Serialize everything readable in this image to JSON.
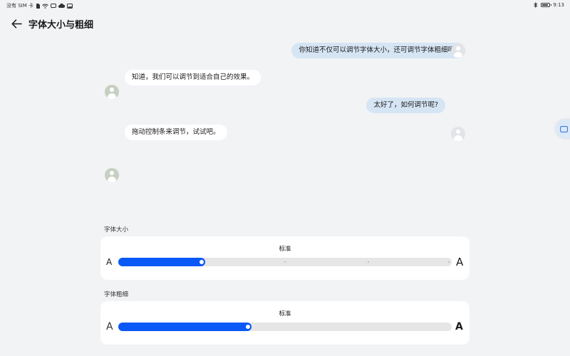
{
  "status_bar": {
    "carrier": "没有 SIM 卡",
    "time": "9:13",
    "battery_level": 0.85,
    "icons_left": [
      "no-sim-icon",
      "wifi-icon",
      "message-icon",
      "cloud-icon",
      "gallery-icon"
    ],
    "icons_right": [
      "bluetooth-icon",
      "battery-icon"
    ]
  },
  "header": {
    "title": "字体大小与粗细",
    "back_icon": "arrow-left-icon"
  },
  "chat": {
    "messages": [
      {
        "side": "right",
        "text": "你知道不仅可以调节字体大小，还可调节字体粗细吗?"
      },
      {
        "side": "left",
        "text": "知道，我们可以调节到适合自己的效果。"
      },
      {
        "side": "right",
        "text": "太好了，如何调节呢?"
      },
      {
        "side": "left",
        "text": "拖动控制条来调节，试试吧。"
      }
    ]
  },
  "font_size": {
    "label": "字体大小",
    "value_label": "标准",
    "min_glyph": "A",
    "max_glyph": "A",
    "level": 0.26,
    "ticks": [
      0.5,
      0.75,
      1.0
    ]
  },
  "font_weight": {
    "label": "字体粗细",
    "value_label": "标准",
    "min_glyph": "A",
    "max_glyph": "A",
    "level": 0.4
  },
  "colors": {
    "accent": "#0a59f7",
    "background": "#f1f3f5",
    "user_bubble": "#d6e5f4",
    "bot_bubble": "#ffffff",
    "track": "#e6e6e6"
  }
}
